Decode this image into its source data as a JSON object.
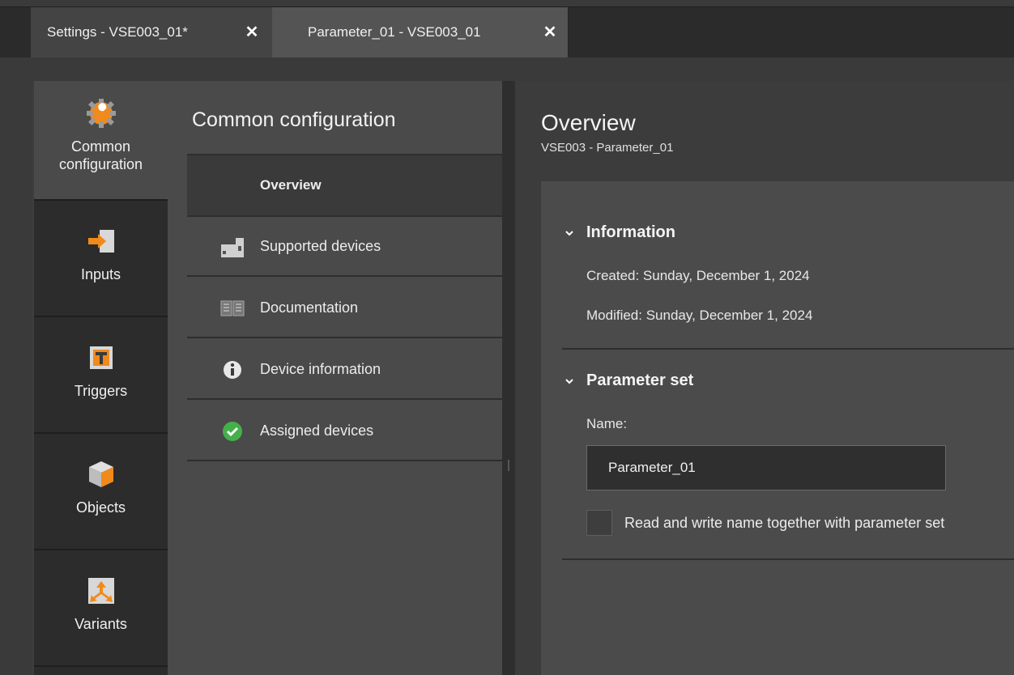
{
  "tabs": [
    {
      "label": "Settings - VSE003_01*",
      "close": "✕"
    },
    {
      "label": "Parameter_01 - VSE003_01",
      "close": "✕"
    }
  ],
  "leftnav": {
    "items": [
      {
        "label_line1": "Common",
        "label_line2": "configuration",
        "icon": "gear-wrench-icon",
        "active": true
      },
      {
        "label": "Inputs",
        "icon": "input-arrow-icon"
      },
      {
        "label": "Triggers",
        "icon": "trigger-t-icon"
      },
      {
        "label": "Objects",
        "icon": "cube-icon"
      },
      {
        "label": "Variants",
        "icon": "variants-icon"
      }
    ]
  },
  "submenu": {
    "title": "Common configuration",
    "items": [
      {
        "label": "Overview",
        "active": true
      },
      {
        "label": "Supported devices",
        "icon": "devices-icon"
      },
      {
        "label": "Documentation",
        "icon": "book-icon"
      },
      {
        "label": "Device information",
        "icon": "info-icon"
      },
      {
        "label": "Assigned devices",
        "icon": "check-circle-icon"
      }
    ]
  },
  "content": {
    "title": "Overview",
    "subtitle": "VSE003 - Parameter_01",
    "information": {
      "heading": "Information",
      "created": "Created: Sunday, December 1, 2024",
      "modified": "Modified: Sunday, December 1, 2024"
    },
    "parameter_set": {
      "heading": "Parameter set",
      "name_label": "Name:",
      "name_value": "Parameter_01",
      "checkbox_label": "Read and write name together with parameter set",
      "checkbox_checked": false
    }
  },
  "colors": {
    "accent_orange": "#f08a1c",
    "check_green": "#44b04a"
  }
}
